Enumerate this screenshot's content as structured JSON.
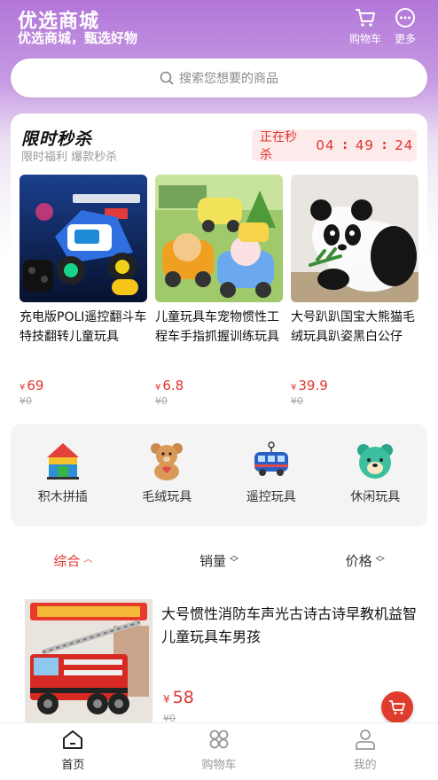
{
  "header": {
    "title": "优选商城",
    "subtitle": "优选商城，甄选好物",
    "cart_label": "购物车",
    "more_label": "更多"
  },
  "search": {
    "placeholder": "搜索您想要的商品"
  },
  "flash_sale": {
    "title": "限时秒杀",
    "subtitle": "限时福利 爆款秒杀",
    "timer_label": "正在秒杀",
    "hours": "04",
    "minutes": "49",
    "seconds": "24",
    "items": [
      {
        "name": "充电版POLI遥控翻斗车特技翻转儿童玩具",
        "currency": "¥",
        "price": "69",
        "original": "¥0"
      },
      {
        "name": "儿童玩具车宠物惯性工程车手指抓握训练玩具",
        "currency": "¥",
        "price": "6.8",
        "original": "¥0"
      },
      {
        "name": "大号趴趴国宝大熊猫毛绒玩具趴姿黑白公仔",
        "currency": "¥",
        "price": "39.9",
        "original": "¥0"
      }
    ]
  },
  "categories": [
    {
      "label": "积木拼插",
      "icon": "blocks-icon"
    },
    {
      "label": "毛绒玩具",
      "icon": "teddy-bear-icon"
    },
    {
      "label": "遥控玩具",
      "icon": "rc-bus-icon"
    },
    {
      "label": "休闲玩具",
      "icon": "bear-face-icon"
    }
  ],
  "sort": {
    "overall": "综合",
    "sales": "销量",
    "price": "价格"
  },
  "product": {
    "title": "大号惯性消防车声光古诗古诗早教机益智儿童玩具车男孩",
    "currency": "¥",
    "price": "58",
    "original": "¥0"
  },
  "tabbar": {
    "home": "首页",
    "cart": "购物车",
    "mine": "我的"
  },
  "colors": {
    "accent": "#e0342e",
    "header_purple": "#b276d8"
  }
}
